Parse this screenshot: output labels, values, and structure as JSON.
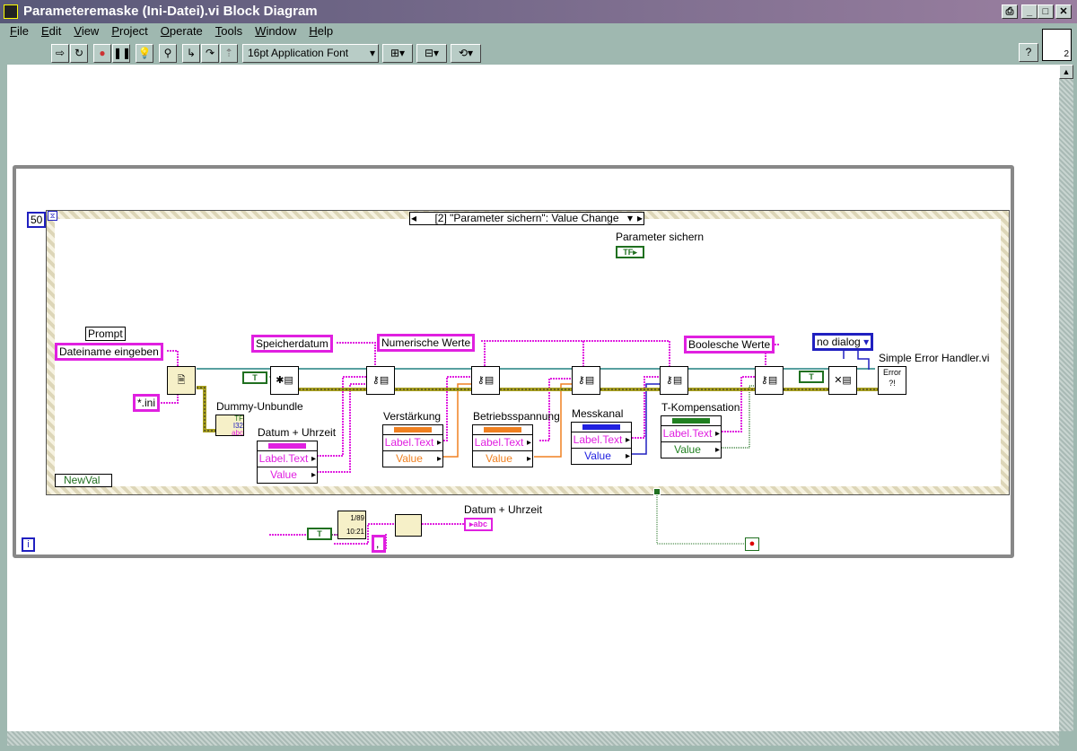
{
  "window": {
    "title": "Parameteremaske (Ini-Datei).vi Block Diagram"
  },
  "menu": [
    "File",
    "Edit",
    "View",
    "Project",
    "Operate",
    "Tools",
    "Window",
    "Help"
  ],
  "toolbar": {
    "font": "16pt Application Font",
    "help": "?",
    "icon_number": "2"
  },
  "diagram": {
    "loop_count": "50",
    "iteration": "i",
    "event_case": "[2] \"Parameter sichern\": Value Change",
    "event_data_node": "NewVal",
    "parameter_sichern": "Parameter sichern",
    "prompt_label": "Prompt",
    "prompt_value": "Dateiname eingeben",
    "pattern": "*.ini",
    "dummy_unbundle": "Dummy-Unbundle",
    "keys": [
      "Speicherdatum",
      "Numerische Werte",
      "Boolesche Werte"
    ],
    "no_dialog": "no dialog",
    "error_handler": "Simple Error Handler.vi",
    "property_nodes": [
      {
        "label": "Datum + Uhrzeit",
        "color": "#e020e0",
        "rows": [
          "Label.Text",
          "Value"
        ]
      },
      {
        "label": "Verstärkung",
        "color": "#f08020",
        "rows": [
          "Label.Text",
          "Value"
        ]
      },
      {
        "label": "Betriebsspannung",
        "color": "#f08020",
        "rows": [
          "Label.Text",
          "Value"
        ]
      },
      {
        "label": "Messkanal",
        "color": "#2020e0",
        "rows": [
          "Label.Text",
          "Value"
        ]
      },
      {
        "label": "T-Kompensation",
        "color": "#208020",
        "rows": [
          "Label.Text",
          "Value"
        ]
      }
    ],
    "true_const": "T",
    "date_label": "Datum + Uhrzeit",
    "date_indicator": "abc",
    "date_fmt": "1/89",
    "time_fmt": "10:21",
    "separator": ","
  },
  "colors": {
    "string": "#e020e0",
    "numeric": "#f08020",
    "boolean": "#208020",
    "enum": "#2020e0"
  }
}
